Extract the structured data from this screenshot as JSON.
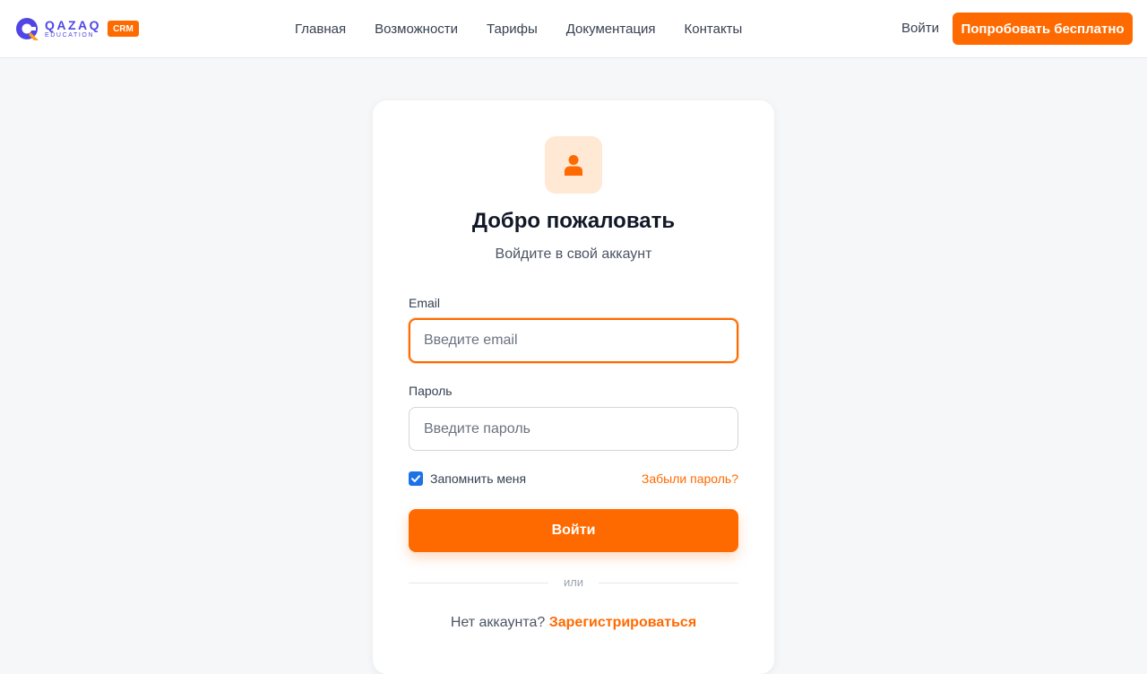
{
  "brand": {
    "name": "QAZAQ",
    "subname": "EDUCATION",
    "badge": "CRM",
    "colors": {
      "primary": "#ff6a00",
      "brand_logo": "#4f46e5"
    }
  },
  "nav": {
    "links": [
      "Главная",
      "Возможности",
      "Тарифы",
      "Документация",
      "Контакты"
    ],
    "login_label": "Войти",
    "cta_label": "Попробовать бесплатно"
  },
  "card": {
    "icon": "user-icon",
    "title": "Добро пожаловать",
    "subtitle": "Войдите в свой аккаунт",
    "email": {
      "label": "Email",
      "placeholder": "Введите email",
      "value": ""
    },
    "password": {
      "label": "Пароль",
      "placeholder": "Введите пароль",
      "value": ""
    },
    "remember_label": "Запомнить меня",
    "remember_checked": true,
    "forgot_label": "Забыли пароль?",
    "submit_label": "Войти",
    "divider": "или",
    "signup_prompt": "Нет аккаунта?",
    "signup_link": "Зарегистрироваться"
  }
}
